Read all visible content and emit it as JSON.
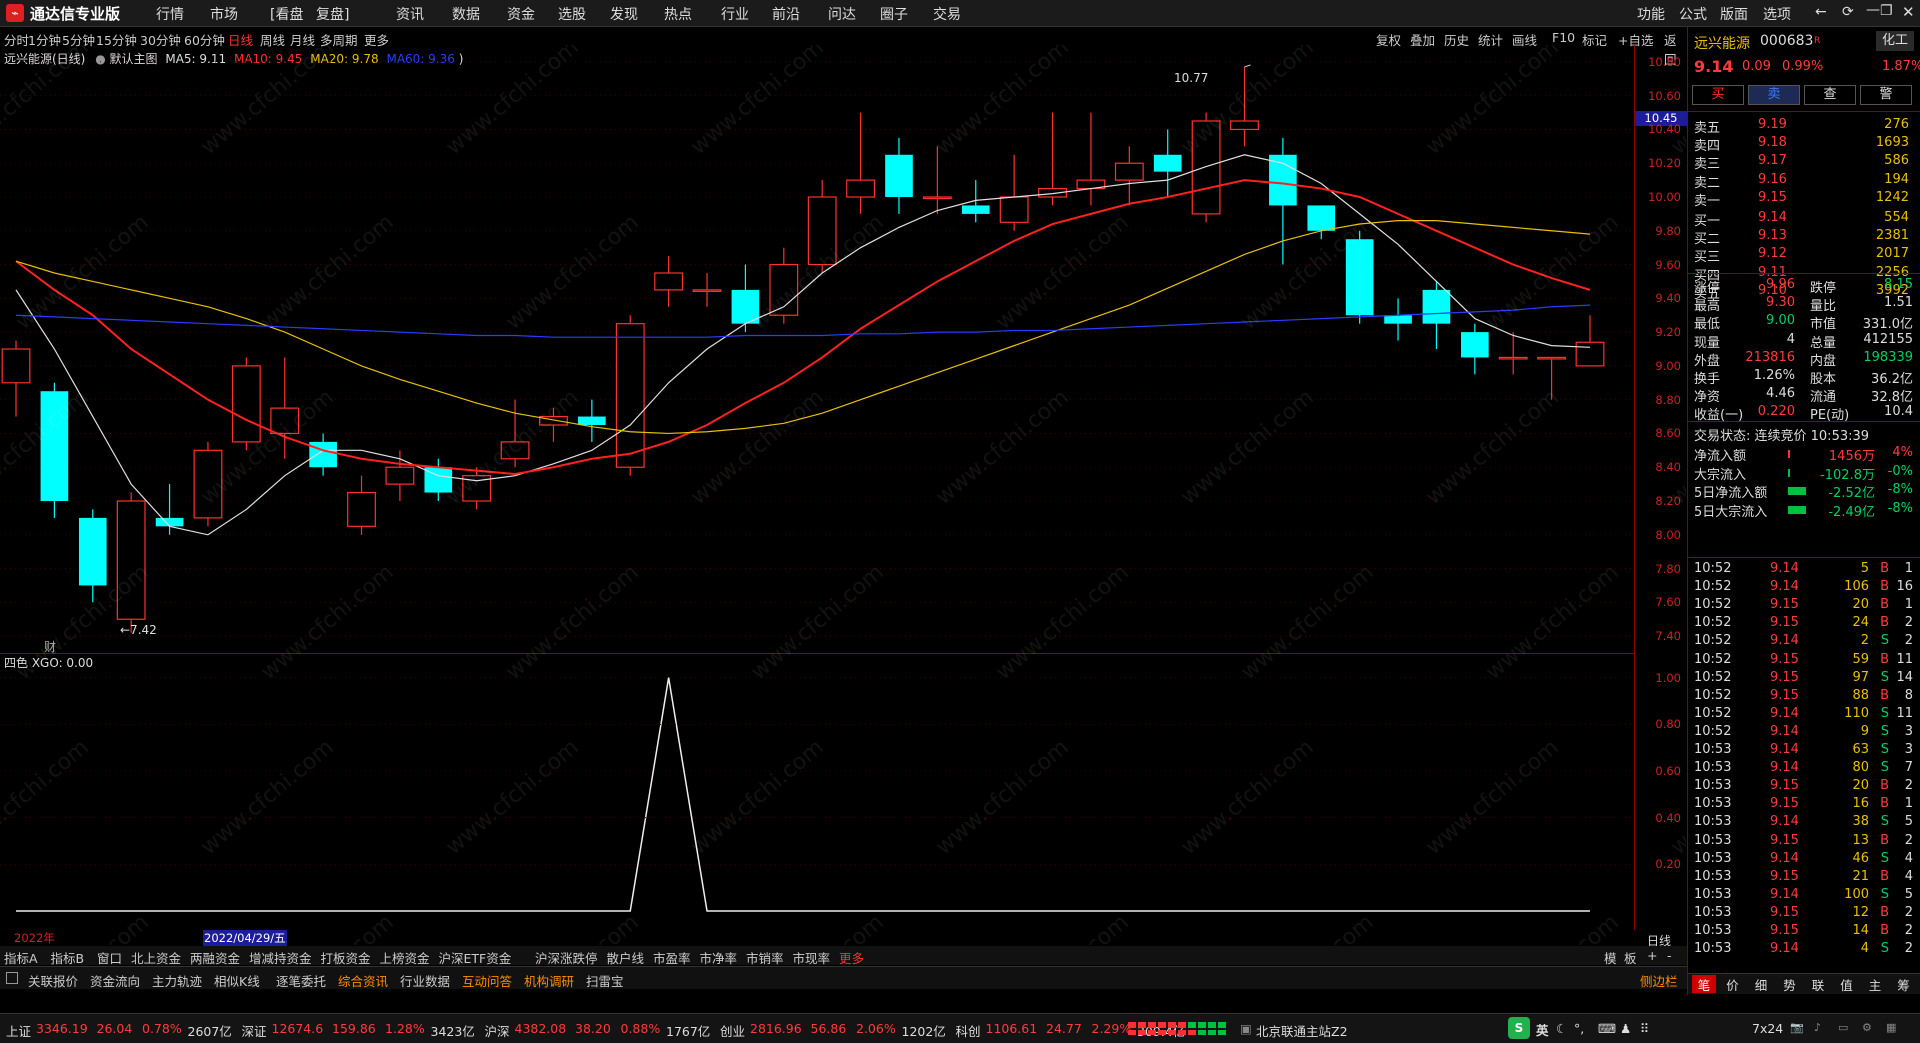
{
  "app": {
    "title": "通达信专业版"
  },
  "top_menu": [
    "行情",
    "市场",
    "[看盘",
    "复盘]",
    "资讯",
    "数据",
    "资金",
    "选股",
    "发现",
    "热点",
    "行业",
    "前沿",
    "问达",
    "圈子",
    "交易"
  ],
  "top_right": [
    "功能",
    "公式",
    "版面",
    "选项"
  ],
  "periods": [
    "分时",
    "1分钟",
    "5分钟",
    "15分钟",
    "30分钟",
    "60分钟",
    "日线",
    "周线",
    "月线",
    "多周期",
    "更多"
  ],
  "active_period": "日线",
  "chart_tools": [
    "复权",
    "叠加",
    "历史",
    "统计",
    "画线",
    "F10",
    "标记",
    "+自选",
    "返回"
  ],
  "main_title": {
    "name": "远兴能源(日线)",
    "template": "默认主图",
    "ma5": "MA5: 9.11",
    "ma10": "MA10: 9.45",
    "ma20": "MA20: 9.78",
    "ma60": "MA60: 9.36"
  },
  "annotations": {
    "high": "10.77",
    "low": "←7.42",
    "cai": "财",
    "current_price_tag": "10.45"
  },
  "indicator_title": "四色  XGO: 0.00",
  "date_label": "2022/04/29/五",
  "year_label": "2022年",
  "day_line_label": "日线",
  "price_axis": [
    "10.80",
    "10.60",
    "10.40",
    "10.20",
    "10.00",
    "9.80",
    "9.60",
    "9.40",
    "9.20",
    "9.00",
    "8.80",
    "8.60",
    "8.40",
    "8.20",
    "8.00",
    "7.80",
    "7.60",
    "7.40"
  ],
  "ind_axis": [
    "1.00",
    "0.80",
    "0.60",
    "0.40",
    "0.20"
  ],
  "chart_data": {
    "type": "candlestick",
    "price_range": [
      7.3,
      10.9
    ],
    "candles": [
      [
        8.9,
        9.1,
        8.7,
        9.15
      ],
      [
        8.85,
        8.2,
        8.1,
        8.9
      ],
      [
        8.1,
        7.7,
        7.6,
        8.15
      ],
      [
        7.5,
        8.2,
        7.42,
        8.25
      ],
      [
        8.1,
        8.05,
        8.0,
        8.3
      ],
      [
        8.1,
        8.5,
        8.05,
        8.55
      ],
      [
        8.55,
        9.0,
        8.5,
        9.05
      ],
      [
        8.6,
        8.75,
        8.45,
        9.05
      ],
      [
        8.55,
        8.4,
        8.35,
        8.6
      ],
      [
        8.05,
        8.25,
        8.0,
        8.35
      ],
      [
        8.3,
        8.4,
        8.2,
        8.5
      ],
      [
        8.4,
        8.25,
        8.2,
        8.45
      ],
      [
        8.2,
        8.35,
        8.15,
        8.4
      ],
      [
        8.45,
        8.55,
        8.4,
        8.8
      ],
      [
        8.65,
        8.7,
        8.55,
        8.75
      ],
      [
        8.7,
        8.65,
        8.55,
        8.8
      ],
      [
        8.4,
        9.25,
        8.35,
        9.3
      ],
      [
        9.45,
        9.55,
        9.35,
        9.65
      ],
      [
        9.45,
        9.45,
        9.35,
        9.55
      ],
      [
        9.45,
        9.25,
        9.2,
        9.6
      ],
      [
        9.3,
        9.6,
        9.25,
        9.7
      ],
      [
        9.6,
        10.0,
        9.55,
        10.1
      ],
      [
        10.0,
        10.1,
        9.9,
        10.5
      ],
      [
        10.25,
        10.0,
        9.9,
        10.35
      ],
      [
        10.0,
        10.0,
        9.9,
        10.3
      ],
      [
        9.95,
        9.9,
        9.85,
        10.1
      ],
      [
        9.85,
        10.0,
        9.8,
        10.25
      ],
      [
        10.0,
        10.05,
        9.95,
        10.5
      ],
      [
        10.05,
        10.1,
        9.95,
        10.5
      ],
      [
        10.1,
        10.2,
        9.95,
        10.3
      ],
      [
        10.25,
        10.15,
        10.0,
        10.4
      ],
      [
        9.9,
        10.45,
        9.85,
        10.5
      ],
      [
        10.4,
        10.45,
        10.3,
        10.77
      ],
      [
        10.25,
        9.95,
        9.6,
        10.35
      ],
      [
        9.95,
        9.8,
        9.75,
        9.95
      ],
      [
        9.75,
        9.3,
        9.25,
        9.8
      ],
      [
        9.3,
        9.25,
        9.15,
        9.4
      ],
      [
        9.45,
        9.25,
        9.1,
        9.5
      ],
      [
        9.2,
        9.05,
        8.95,
        9.25
      ],
      [
        9.05,
        9.05,
        8.95,
        9.2
      ],
      [
        9.05,
        9.05,
        8.8,
        9.05
      ],
      [
        9.0,
        9.14,
        9.0,
        9.3
      ]
    ],
    "ma5": [
      9.45,
      9.1,
      8.7,
      8.3,
      8.05,
      8.0,
      8.15,
      8.35,
      8.5,
      8.5,
      8.45,
      8.35,
      8.32,
      8.35,
      8.42,
      8.5,
      8.65,
      8.9,
      9.1,
      9.25,
      9.35,
      9.55,
      9.7,
      9.82,
      9.92,
      9.98,
      10.0,
      10.02,
      10.05,
      10.08,
      10.1,
      10.18,
      10.25,
      10.2,
      10.08,
      9.9,
      9.72,
      9.5,
      9.28,
      9.18,
      9.12,
      9.11
    ],
    "ma10": [
      9.62,
      9.45,
      9.3,
      9.1,
      8.95,
      8.8,
      8.68,
      8.58,
      8.5,
      8.45,
      8.42,
      8.4,
      8.38,
      8.36,
      8.4,
      8.45,
      8.48,
      8.55,
      8.65,
      8.78,
      8.9,
      9.05,
      9.22,
      9.36,
      9.5,
      9.62,
      9.74,
      9.84,
      9.9,
      9.96,
      10.0,
      10.05,
      10.1,
      10.08,
      10.05,
      10.0,
      9.9,
      9.8,
      9.7,
      9.6,
      9.52,
      9.45
    ],
    "ma20": [
      9.62,
      9.55,
      9.5,
      9.45,
      9.4,
      9.35,
      9.28,
      9.2,
      9.1,
      9.0,
      8.92,
      8.85,
      8.78,
      8.72,
      8.68,
      8.64,
      8.61,
      8.6,
      8.61,
      8.63,
      8.66,
      8.72,
      8.8,
      8.88,
      8.96,
      9.04,
      9.12,
      9.2,
      9.28,
      9.36,
      9.46,
      9.56,
      9.66,
      9.74,
      9.8,
      9.84,
      9.86,
      9.86,
      9.84,
      9.82,
      9.8,
      9.78
    ],
    "ma60": [
      9.3,
      9.29,
      9.28,
      9.27,
      9.26,
      9.25,
      9.24,
      9.23,
      9.22,
      9.21,
      9.2,
      9.19,
      9.18,
      9.18,
      9.17,
      9.17,
      9.17,
      9.17,
      9.17,
      9.18,
      9.18,
      9.18,
      9.19,
      9.19,
      9.2,
      9.2,
      9.21,
      9.21,
      9.22,
      9.23,
      9.24,
      9.25,
      9.26,
      9.27,
      9.28,
      9.29,
      9.3,
      9.31,
      9.32,
      9.33,
      9.35,
      9.36
    ],
    "xgo": [
      0,
      0,
      0,
      0,
      0,
      0,
      0,
      0,
      0,
      0,
      0,
      0,
      0,
      0,
      0,
      0,
      0,
      1,
      0,
      0,
      0,
      0,
      0,
      0,
      0,
      0,
      0,
      0,
      0,
      0,
      0,
      0,
      0,
      0,
      0,
      0,
      0,
      0,
      0,
      0,
      0,
      0
    ]
  },
  "quote": {
    "name": "远兴能源",
    "code": "000683",
    "tag": "R",
    "sector": "化工",
    "price": "9.14",
    "change": "0.09",
    "pct": "0.99%",
    "side_pct": "1.87%",
    "buttons": [
      "买",
      "卖",
      "查",
      "警"
    ],
    "asks": [
      [
        "卖五",
        "9.19",
        "276"
      ],
      [
        "卖四",
        "9.18",
        "1693"
      ],
      [
        "卖三",
        "9.17",
        "586"
      ],
      [
        "卖二",
        "9.16",
        "194"
      ],
      [
        "卖一",
        "9.15",
        "1242"
      ]
    ],
    "bids": [
      [
        "买一",
        "9.14",
        "554"
      ],
      [
        "买二",
        "9.13",
        "2381"
      ],
      [
        "买三",
        "9.12",
        "2017"
      ],
      [
        "买四",
        "9.11",
        "2256"
      ],
      [
        "买五",
        "9.10",
        "3992"
      ]
    ],
    "stats": [
      [
        "涨停",
        "9.96",
        "跌停",
        "8.15"
      ],
      [
        "最高",
        "9.30",
        "量比",
        "1.51"
      ],
      [
        "最低",
        "9.00",
        "市值",
        "331.0亿"
      ],
      [
        "现量",
        "4",
        "总量",
        "412155"
      ],
      [
        "外盘",
        "213816",
        "内盘",
        "198339"
      ],
      [
        "换手",
        "1.26%",
        "股本",
        "36.2亿"
      ],
      [
        "净资",
        "4.46",
        "流通",
        "32.8亿"
      ],
      [
        "收益(一)",
        "0.220",
        "PE(动)",
        "10.4"
      ]
    ],
    "trade_status": "交易状态: 连续竞价 10:53:39",
    "flows": [
      [
        "净流入额",
        "1456万",
        "4%"
      ],
      [
        "大宗流入",
        "-102.8万",
        "-0%"
      ],
      [
        "5日净流入额",
        "-2.52亿",
        "-8%"
      ],
      [
        "5日大宗流入",
        "-2.49亿",
        "-8%"
      ]
    ],
    "ticks": [
      [
        "10:52",
        "9.14",
        "5",
        "B",
        "1"
      ],
      [
        "10:52",
        "9.14",
        "106",
        "B",
        "16"
      ],
      [
        "10:52",
        "9.15",
        "20",
        "B",
        "1"
      ],
      [
        "10:52",
        "9.15",
        "24",
        "B",
        "2"
      ],
      [
        "10:52",
        "9.14",
        "2",
        "S",
        "2"
      ],
      [
        "10:52",
        "9.15",
        "59",
        "B",
        "11"
      ],
      [
        "10:52",
        "9.15",
        "97",
        "S",
        "14"
      ],
      [
        "10:52",
        "9.15",
        "88",
        "B",
        "8"
      ],
      [
        "10:52",
        "9.14",
        "110",
        "S",
        "11"
      ],
      [
        "10:52",
        "9.14",
        "9",
        "S",
        "3"
      ],
      [
        "10:53",
        "9.14",
        "63",
        "S",
        "3"
      ],
      [
        "10:53",
        "9.14",
        "80",
        "S",
        "7"
      ],
      [
        "10:53",
        "9.15",
        "20",
        "B",
        "2"
      ],
      [
        "10:53",
        "9.15",
        "16",
        "B",
        "1"
      ],
      [
        "10:53",
        "9.14",
        "38",
        "S",
        "5"
      ],
      [
        "10:53",
        "9.15",
        "13",
        "B",
        "2"
      ],
      [
        "10:53",
        "9.14",
        "46",
        "S",
        "4"
      ],
      [
        "10:53",
        "9.15",
        "21",
        "B",
        "4"
      ],
      [
        "10:53",
        "9.14",
        "100",
        "S",
        "5"
      ],
      [
        "10:53",
        "9.15",
        "12",
        "B",
        "2"
      ],
      [
        "10:53",
        "9.15",
        "14",
        "B",
        "2"
      ],
      [
        "10:53",
        "9.14",
        "4",
        "S",
        "2"
      ]
    ],
    "bottom_tabs": [
      "笔",
      "价",
      "细",
      "势",
      "联",
      "值",
      "主",
      "筹"
    ]
  },
  "tabs1": [
    "指标A",
    "指标B",
    "窗口",
    "北上资金",
    "两融资金",
    "增减持资金",
    "打板资金",
    "上榜资金",
    "沪深ETF资金",
    "沪深涨跌停",
    "散户线",
    "市盈率",
    "市净率",
    "市销率",
    "市现率",
    "更多"
  ],
  "tabs1_right": [
    "模",
    "板",
    "+",
    "-"
  ],
  "tabs2": [
    "关联报价",
    "资金流向",
    "主力轨迹",
    "相似K线",
    "逐笔委托",
    "综合资讯",
    "行业数据",
    "互动问答",
    "机构调研",
    "扫雷宝"
  ],
  "tabs2_right": "侧边栏",
  "status": {
    "items": [
      [
        "上证",
        "3346.19",
        "26.04",
        "0.78%",
        "2607亿"
      ],
      [
        "深证",
        "12674.6",
        "159.86",
        "1.28%",
        "3423亿"
      ],
      [
        "沪深",
        "4382.08",
        "38.20",
        "0.88%",
        "1767亿"
      ],
      [
        "创业",
        "2816.96",
        "56.86",
        "2.06%",
        "1202亿"
      ],
      [
        "科创",
        "1106.61",
        "24.77",
        "2.29%",
        "309.4亿"
      ]
    ],
    "server": "北京联通主站Z2",
    "mode": "7x24",
    "ime": "英"
  },
  "watermark": "www.cfchi.com"
}
